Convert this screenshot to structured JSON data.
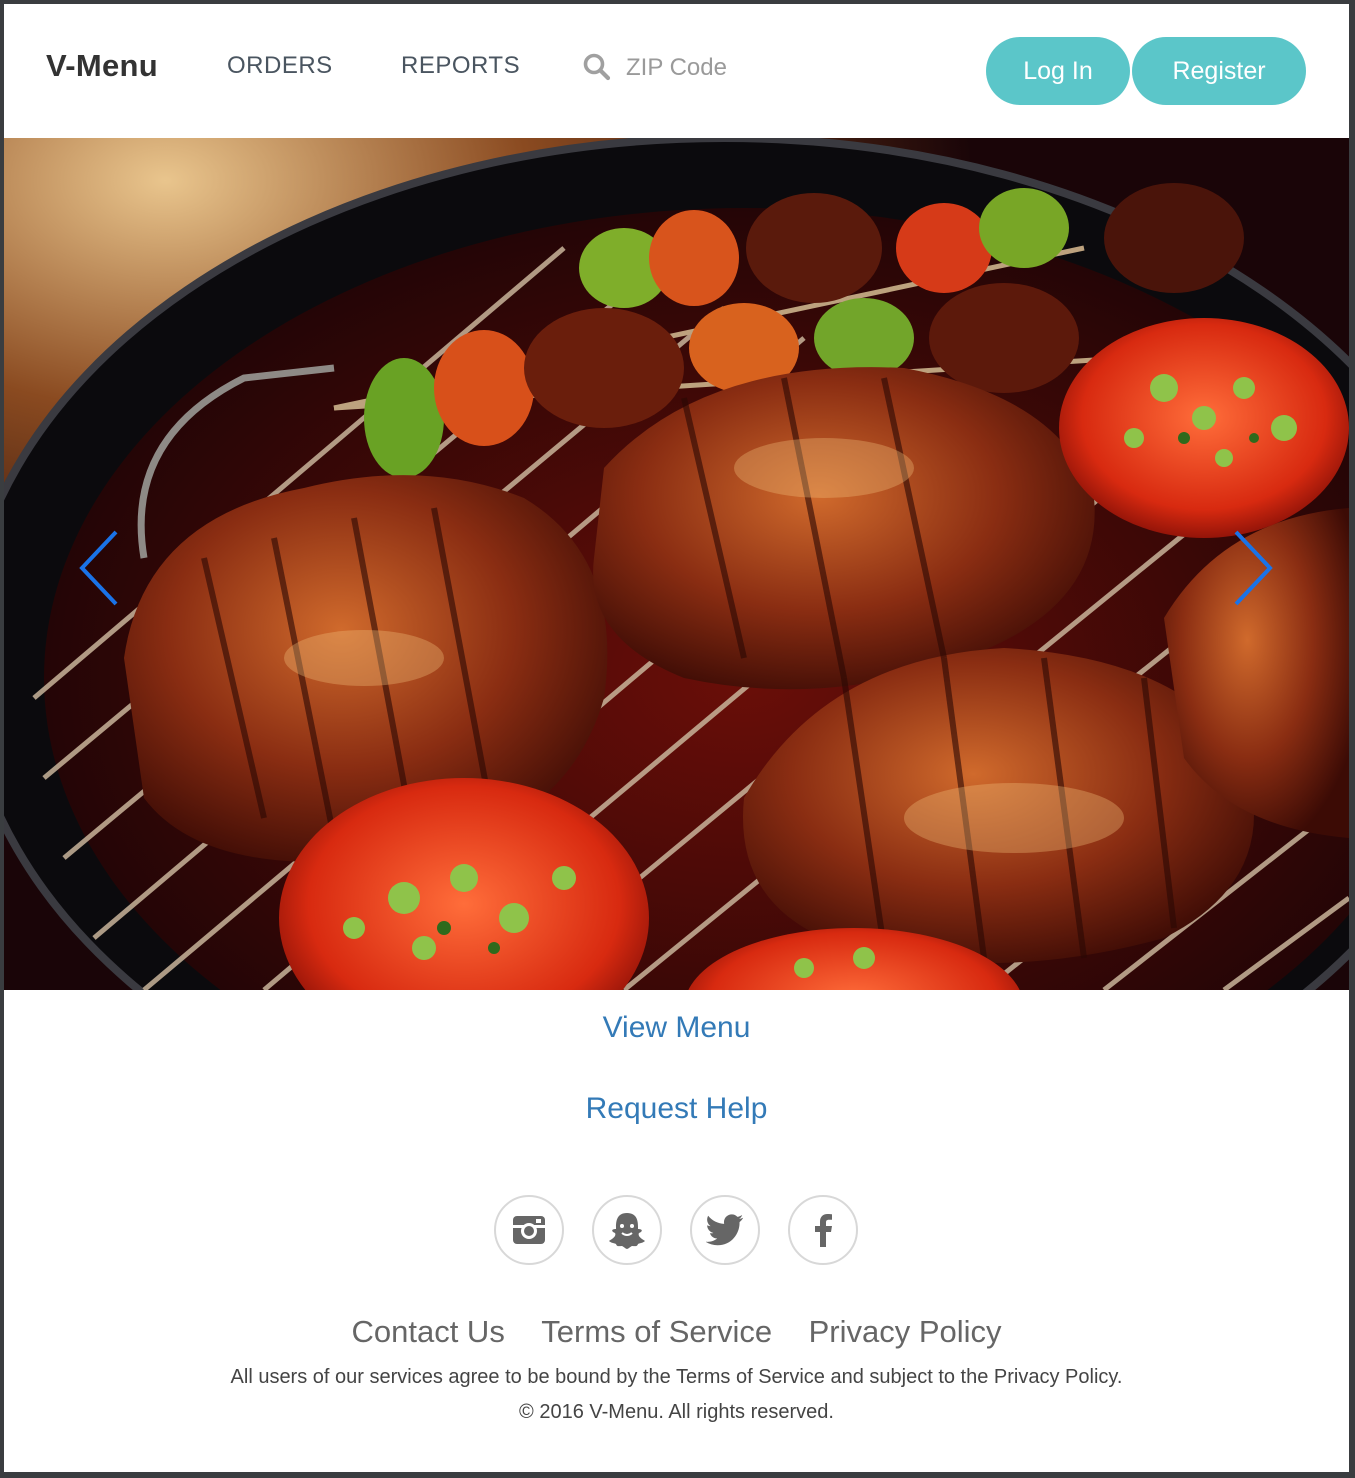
{
  "navbar": {
    "brand": "V-Menu",
    "links": [
      "ORDERS",
      "REPORTS"
    ],
    "search": {
      "placeholder": "ZIP Code",
      "value": "",
      "icon": "search-icon"
    },
    "login_label": "Log In",
    "register_label": "Register",
    "accent_color": "#5bc6c9"
  },
  "carousel": {
    "image": "grilled steaks, tomatoes and vegetable skewers on a barbecue grill",
    "prev_icon": "chevron-left-icon",
    "next_icon": "chevron-right-icon",
    "arrow_color": "#1a73e8"
  },
  "main": {
    "view_menu": "View Menu",
    "request_help": "Request Help",
    "link_color": "#337ab7"
  },
  "social": [
    "instagram-icon",
    "snapchat-icon",
    "twitter-icon",
    "facebook-icon"
  ],
  "footer": {
    "links": [
      "Contact Us",
      "Terms of Service",
      "Privacy Policy"
    ],
    "notice": "All users of our services agree to be bound by the Terms of Service and subject to the Privacy Policy.",
    "copyright": "© 2016 V-Menu. All rights reserved."
  }
}
